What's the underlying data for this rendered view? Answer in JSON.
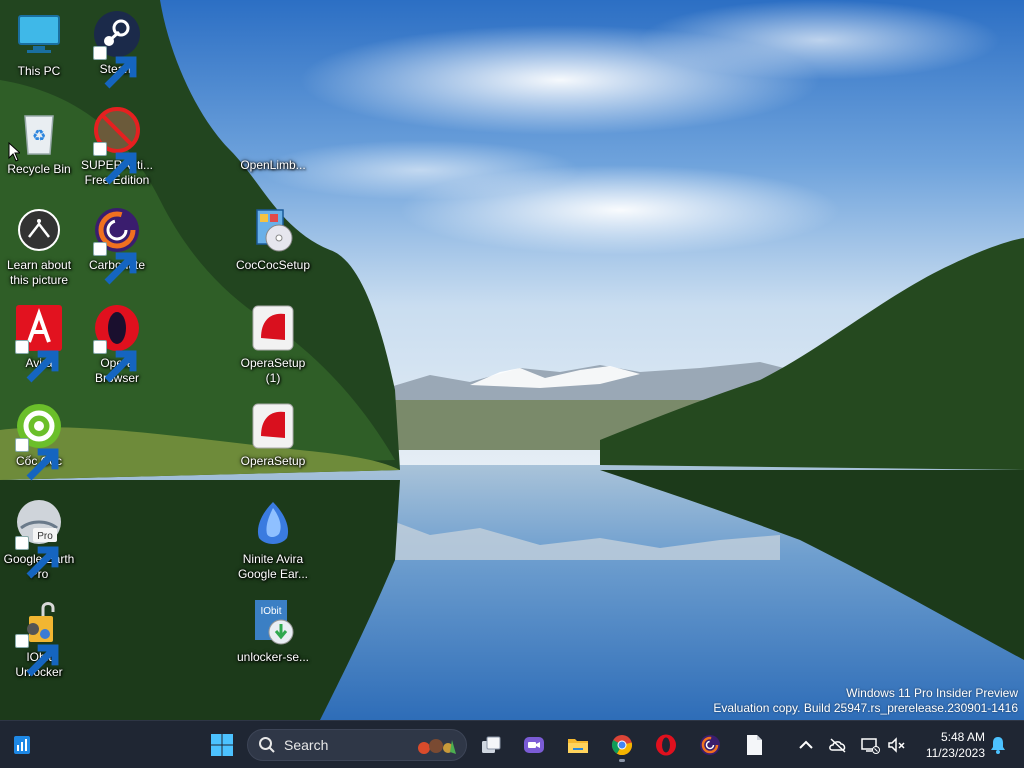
{
  "desktop": {
    "icons": [
      {
        "label": "This PC"
      },
      {
        "label": "Steam"
      },
      {
        "label": "Recycle Bin"
      },
      {
        "label": "SUPERAnti...\nFree Edition"
      },
      {
        "label": "OpenLimb..."
      },
      {
        "label": "Learn about\nthis picture"
      },
      {
        "label": "Carbonate"
      },
      {
        "label": "CocCocSetup"
      },
      {
        "label": "Avira"
      },
      {
        "label": "Opera\nBrowser"
      },
      {
        "label": "OperaSetup\n(1)"
      },
      {
        "label": "Cốc Cốc"
      },
      {
        "label": "OperaSetup"
      },
      {
        "label": "Google Earth\nPro"
      },
      {
        "label": "Ninite Avira\nGoogle Ear..."
      },
      {
        "label": "IObit\nUnlocker"
      },
      {
        "label": "unlocker-se..."
      }
    ],
    "google_earth_badge": "Pro",
    "iobit_badge": "IObit"
  },
  "watermark": {
    "line1": "Windows 11 Pro Insider Preview",
    "line2": "Evaluation copy. Build 25947.rs_prerelease.230901-1416"
  },
  "taskbar": {
    "search_placeholder": "Search",
    "pinned": [
      "start-icon",
      "task-view-icon",
      "meet-icon",
      "file-explorer-icon",
      "chrome-icon",
      "opera-icon",
      "carbonate-icon",
      "notepad-icon"
    ],
    "clock": {
      "time": "5:48 AM",
      "date": "11/23/2023"
    }
  },
  "colors": {
    "taskbar_bg": "#1f2633",
    "accent": "#0078d4"
  }
}
